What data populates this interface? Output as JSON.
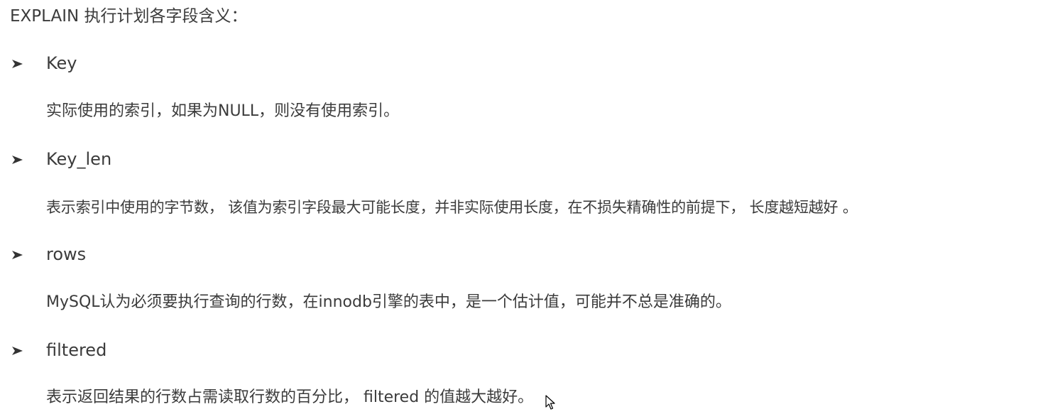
{
  "document": {
    "title": "EXPLAIN 执行计划各字段含义：",
    "fields": [
      {
        "term": "Key",
        "description": "实际使用的索引，如果为NULL，则没有使用索引。"
      },
      {
        "term": "Key_len",
        "description": "表示索引中使用的字节数， 该值为索引字段最大可能长度，并非实际使用长度，在不损失精确性的前提下， 长度越短越好 。"
      },
      {
        "term": "rows",
        "description": "MySQL认为必须要执行查询的行数，在innodb引擎的表中，是一个估计值，可能并不总是准确的。"
      },
      {
        "term": "filtered",
        "description": "表示返回结果的行数占需读取行数的百分比， filtered 的值越大越好。"
      }
    ],
    "bullet_icon": "arrowhead-bullet-icon",
    "cursor_icon": "mouse-pointer-icon",
    "text_color": "#3b3b3b"
  }
}
